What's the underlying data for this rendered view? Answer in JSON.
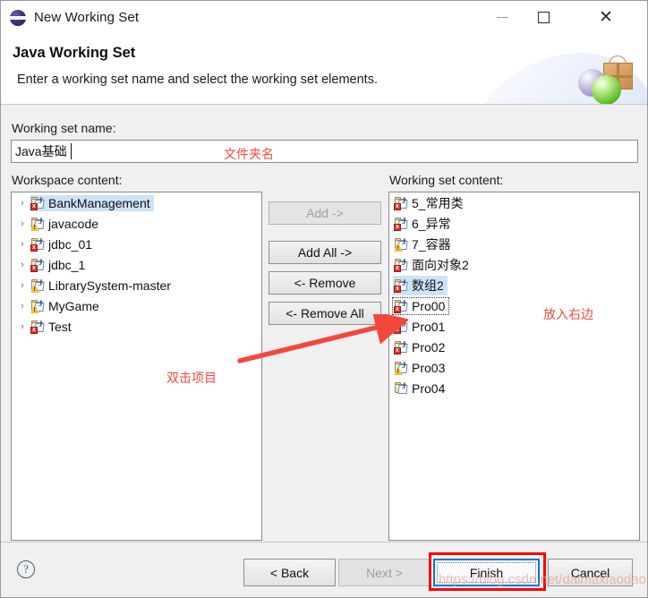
{
  "window": {
    "title": "New Working Set",
    "icon": "eclipse-icon",
    "minimize_label": "–",
    "maximize_label": "",
    "close_label": "✕"
  },
  "header": {
    "title": "Java Working Set",
    "description": "Enter a working set name and select the working set elements."
  },
  "form": {
    "name_label": "Working set name:",
    "name_value": "Java基础",
    "name_placeholder": ""
  },
  "workspace": {
    "label": "Workspace content:",
    "items": [
      {
        "label": "BankManagement",
        "badge": "error",
        "selected": true,
        "focus": false,
        "expandable": true
      },
      {
        "label": "javacode",
        "badge": "warning",
        "selected": false,
        "focus": false,
        "expandable": true
      },
      {
        "label": "jdbc_01",
        "badge": "error",
        "selected": false,
        "focus": false,
        "expandable": true
      },
      {
        "label": "jdbc_1",
        "badge": "error",
        "selected": false,
        "focus": false,
        "expandable": true
      },
      {
        "label": "LibrarySystem-master",
        "badge": "warning",
        "selected": false,
        "focus": false,
        "expandable": true
      },
      {
        "label": "MyGame",
        "badge": "warning",
        "selected": false,
        "focus": false,
        "expandable": true
      },
      {
        "label": "Test",
        "badge": "error",
        "selected": false,
        "focus": false,
        "expandable": true
      }
    ]
  },
  "working_set": {
    "label": "Working set content:",
    "items": [
      {
        "label": "5_常用类",
        "badge": "error",
        "selected": false,
        "focus": false,
        "expandable": false
      },
      {
        "label": "6_异常",
        "badge": "error",
        "selected": false,
        "focus": false,
        "expandable": false
      },
      {
        "label": "7_容器",
        "badge": "warning",
        "selected": false,
        "focus": false,
        "expandable": false
      },
      {
        "label": "面向对象2",
        "badge": "error",
        "selected": false,
        "focus": false,
        "expandable": false
      },
      {
        "label": "数组2",
        "badge": "error",
        "selected": true,
        "focus": false,
        "expandable": false
      },
      {
        "label": "Pro00",
        "badge": "error",
        "selected": false,
        "focus": true,
        "expandable": false
      },
      {
        "label": "Pro01",
        "badge": "error",
        "selected": false,
        "focus": false,
        "expandable": false
      },
      {
        "label": "Pro02",
        "badge": "error",
        "selected": false,
        "focus": false,
        "expandable": false
      },
      {
        "label": "Pro03",
        "badge": "warning",
        "selected": false,
        "focus": false,
        "expandable": false
      },
      {
        "label": "Pro04",
        "badge": "none",
        "selected": false,
        "focus": false,
        "expandable": false
      }
    ]
  },
  "transfer_buttons": {
    "add": "Add ->",
    "add_all": "Add All ->",
    "remove": "<- Remove",
    "remove_all": "<- Remove All",
    "add_enabled": false
  },
  "footer": {
    "help": "?",
    "back": "< Back",
    "next": "Next >",
    "finish": "Finish",
    "cancel": "Cancel",
    "next_enabled": false,
    "finish_is_default": true
  },
  "annotations": {
    "folder_name": "文件夹名",
    "double_click": "双击项目",
    "put_right": "放入右边",
    "arrow_color": "#f4473c",
    "finish_box_color": "#ff0000"
  },
  "watermark": {
    "text": "https://blog.csdn.net/daimaxiaodao"
  }
}
